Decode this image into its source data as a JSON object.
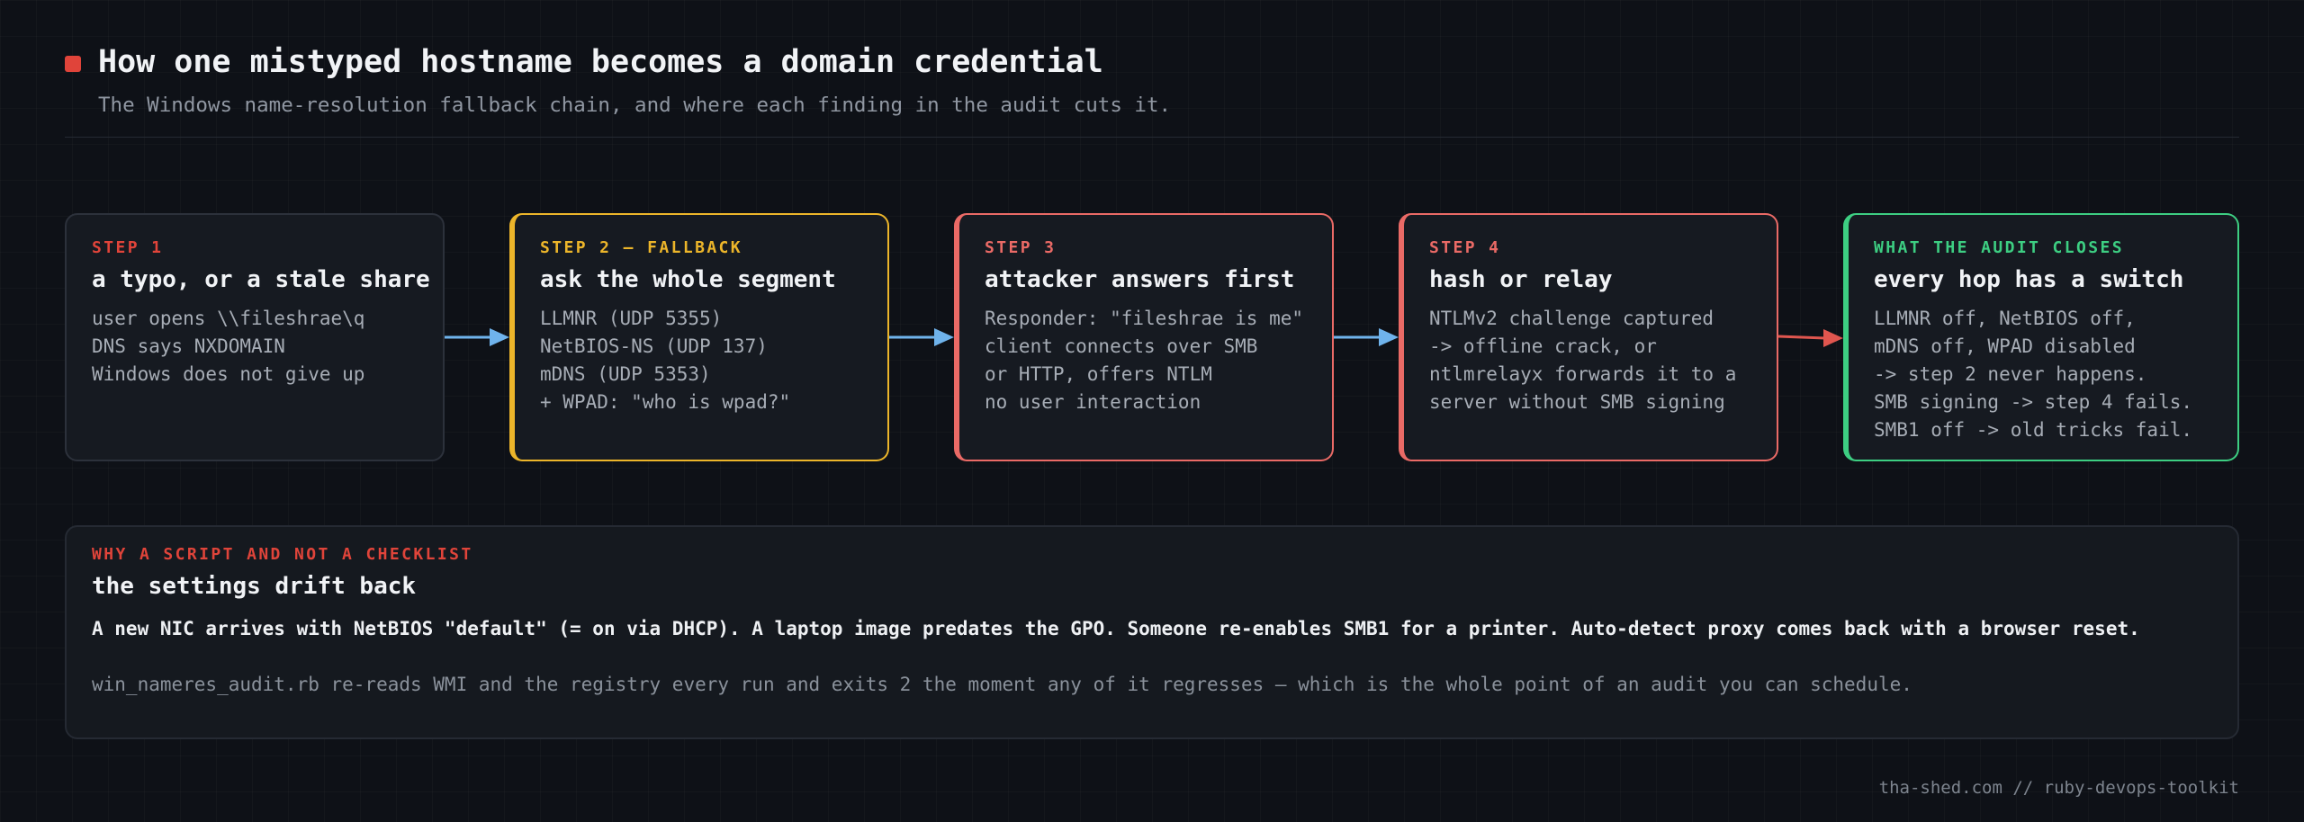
{
  "header": {
    "title": "How one mistyped hostname becomes a domain credential",
    "subtitle": "The Windows name-resolution fallback chain, and where each finding in the audit cuts it."
  },
  "colors": {
    "background": "#0e1117",
    "accent_red": "#e0443a",
    "step_salmon": "#ea6a66",
    "step_yellow": "#ecb52a",
    "step_green": "#3dce82",
    "arrow_blue": "#6fb3ec",
    "arrow_red": "#e0564f"
  },
  "steps": [
    {
      "label": "STEP 1",
      "title": "a typo, or a stale share",
      "lines": [
        "user opens \\\\fileshrae\\q",
        "DNS says NXDOMAIN",
        "Windows does not give up"
      ]
    },
    {
      "label": "STEP 2 — FALLBACK",
      "title": "ask the whole segment",
      "lines": [
        "LLMNR (UDP 5355)",
        "NetBIOS-NS (UDP 137)",
        "mDNS (UDP 5353)",
        "+ WPAD: \"who is wpad?\""
      ]
    },
    {
      "label": "STEP 3",
      "title": "attacker answers first",
      "lines": [
        "Responder: \"fileshrae is me\"",
        "client connects over SMB",
        "or HTTP, offers NTLM",
        "no user interaction"
      ]
    },
    {
      "label": "STEP 4",
      "title": "hash or relay",
      "lines": [
        "NTLMv2 challenge captured",
        "-> offline crack, or",
        "ntlmrelayx forwards it to a",
        "server without SMB signing"
      ]
    },
    {
      "label": "WHAT THE AUDIT CLOSES",
      "title": "every hop has a switch",
      "lines": [
        "LLMNR off, NetBIOS off,",
        "mDNS off, WPAD disabled",
        "-> step 2 never happens.",
        "SMB signing -> step 4 fails.",
        "SMB1 off -> old tricks fail."
      ]
    }
  ],
  "panel": {
    "label": "WHY A SCRIPT AND NOT A CHECKLIST",
    "title": "the settings drift back",
    "lead": "A new NIC arrives with NetBIOS \"default\" (= on via DHCP). A laptop image predates the GPO. Someone re-enables SMB1 for a printer. Auto-detect proxy comes back with a browser reset.",
    "note": "win_nameres_audit.rb re-reads WMI and the registry every run and exits 2 the moment any of it regresses — which is the whole point of an audit you can schedule."
  },
  "footer": {
    "credit": "tha-shed.com // ruby-devops-toolkit"
  }
}
